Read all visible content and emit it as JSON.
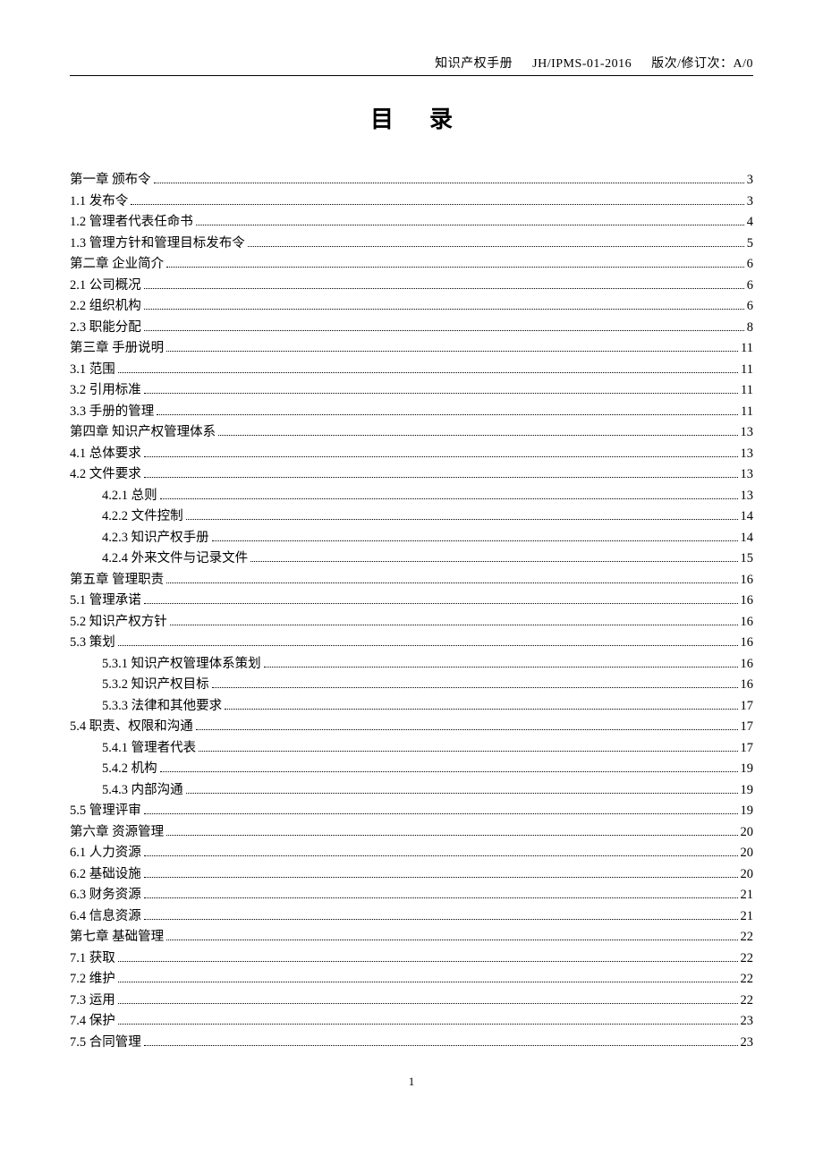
{
  "header": {
    "doc_title": "知识产权手册",
    "doc_no": "JH/IPMS-01-2016",
    "rev": "版次/修订次：A/0"
  },
  "title": "目录",
  "toc": [
    {
      "label": "第一章   颁布令",
      "page": "3",
      "indent": false
    },
    {
      "label": "1.1 发布令",
      "page": "3",
      "indent": false
    },
    {
      "label": "1.2 管理者代表任命书",
      "page": "4",
      "indent": false
    },
    {
      "label": "1.3 管理方针和管理目标发布令",
      "page": "5",
      "indent": false
    },
    {
      "label": "第二章   企业简介",
      "page": "6",
      "indent": false
    },
    {
      "label": "2.1 公司概况",
      "page": "6",
      "indent": false
    },
    {
      "label": "2.2 组织机构",
      "page": "6",
      "indent": false
    },
    {
      "label": "2.3 职能分配",
      "page": "8",
      "indent": false
    },
    {
      "label": "第三章   手册说明",
      "page": "11",
      "indent": false
    },
    {
      "label": "3.1 范围",
      "page": "11",
      "indent": false
    },
    {
      "label": "3.2 引用标准",
      "page": "11",
      "indent": false
    },
    {
      "label": "3.3 手册的管理",
      "page": "11",
      "indent": false
    },
    {
      "label": "第四章   知识产权管理体系",
      "page": "13",
      "indent": false
    },
    {
      "label": "4.1  总体要求",
      "page": "13",
      "indent": false
    },
    {
      "label": "4.2  文件要求",
      "page": "13",
      "indent": false
    },
    {
      "label": "4.2.1  总则",
      "page": "13",
      "indent": true
    },
    {
      "label": "4.2.2  文件控制",
      "page": "14",
      "indent": true
    },
    {
      "label": "4.2.3  知识产权手册",
      "page": "14",
      "indent": true
    },
    {
      "label": "4.2.4  外来文件与记录文件",
      "page": "15",
      "indent": true
    },
    {
      "label": "第五章   管理职责",
      "page": "16",
      "indent": false
    },
    {
      "label": "5.1 管理承诺",
      "page": "16",
      "indent": false
    },
    {
      "label": "5.2  知识产权方针",
      "page": "16",
      "indent": false
    },
    {
      "label": "5.3 策划",
      "page": "16",
      "indent": false
    },
    {
      "label": "5.3.1 知识产权管理体系策划",
      "page": "16",
      "indent": true
    },
    {
      "label": "5.3.2 知识产权目标",
      "page": "16",
      "indent": true
    },
    {
      "label": "5.3.3  法律和其他要求",
      "page": "17",
      "indent": true
    },
    {
      "label": "5.4 职责、权限和沟通",
      "page": "17",
      "indent": false
    },
    {
      "label": "5.4.1 管理者代表",
      "page": "17",
      "indent": true
    },
    {
      "label": "5.4.2 机构",
      "page": "19",
      "indent": true
    },
    {
      "label": "5.4.3 内部沟通",
      "page": "19",
      "indent": true
    },
    {
      "label": "5.5 管理评审",
      "page": "19",
      "indent": false
    },
    {
      "label": "第六章   资源管理",
      "page": "20",
      "indent": false
    },
    {
      "label": "6.1  人力资源",
      "page": "20",
      "indent": false
    },
    {
      "label": "6.2  基础设施",
      "page": "20",
      "indent": false
    },
    {
      "label": "6.3  财务资源",
      "page": "21",
      "indent": false
    },
    {
      "label": "6.4  信息资源",
      "page": "21",
      "indent": false
    },
    {
      "label": "第七章   基础管理",
      "page": "22",
      "indent": false
    },
    {
      "label": "7.1  获取",
      "page": "22",
      "indent": false
    },
    {
      "label": "7.2  维护",
      "page": "22",
      "indent": false
    },
    {
      "label": "7.3  运用",
      "page": "22",
      "indent": false
    },
    {
      "label": "7.4  保护",
      "page": "23",
      "indent": false
    },
    {
      "label": "7.5  合同管理",
      "page": "23",
      "indent": false
    }
  ],
  "footer": {
    "page_no": "1"
  }
}
